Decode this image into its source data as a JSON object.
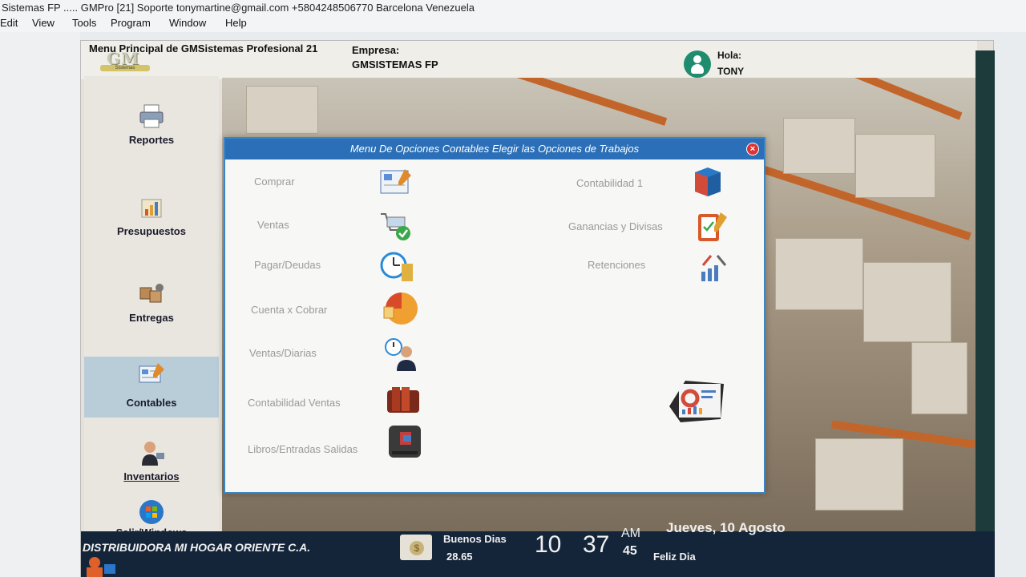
{
  "window": {
    "title": "Sistemas FP ..... GMPro [21] Soporte tonymartine@gmail.com +5804248506770 Barcelona Venezuela"
  },
  "menubar": [
    "Edit",
    "View",
    "Tools",
    "Program",
    "Window",
    "Help"
  ],
  "header": {
    "app_title": "Menu Principal de GMSistemas Profesional 21",
    "empresa_label": "Empresa:",
    "empresa_value": "GMSISTEMAS FP",
    "greeting": "Hola:",
    "user": "TONY",
    "logo_text": "GM",
    "logo_sub": "Sistemas"
  },
  "sidebar": {
    "items": [
      {
        "label": "Reportes",
        "icon": "printer-icon"
      },
      {
        "label": "Presupuestos",
        "icon": "budget-chart-icon"
      },
      {
        "label": "Entregas",
        "icon": "delivery-boxes-icon"
      },
      {
        "label": "Contables",
        "icon": "ledger-pencil-icon"
      },
      {
        "label": "Inventarios",
        "icon": "worker-icon"
      },
      {
        "label": "Salir/Windows",
        "icon": "windows-logo-icon"
      }
    ]
  },
  "dialog": {
    "title": "Menu De Opciones Contables Elegir las Opciones de Trabajos",
    "close_symbol": "×",
    "left_options": [
      {
        "label": "Comprar",
        "icon": "purchase-form-icon"
      },
      {
        "label": "Ventas",
        "icon": "shopping-cart-check-icon"
      },
      {
        "label": "Pagar/Deudas",
        "icon": "clock-payment-icon"
      },
      {
        "label": "Cuenta x Cobrar",
        "icon": "pie-chart-icon"
      },
      {
        "label": "Ventas/Diarias",
        "icon": "clerk-clock-icon"
      },
      {
        "label": "Contabilidad Ventas",
        "icon": "books-icon"
      },
      {
        "label": "Libros/Entradas Salidas",
        "icon": "book-icon"
      }
    ],
    "right_options": [
      {
        "label": "Contabilidad 1",
        "icon": "cube-icon"
      },
      {
        "label": "Ganancias y Divisas",
        "icon": "clipboard-check-icon"
      },
      {
        "label": "Retenciones",
        "icon": "tools-chart-icon"
      }
    ],
    "extra_icon": "dashboard-chart-icon"
  },
  "statusbar": {
    "company": "DISTRIBUIDORA MI HOGAR ORIENTE C.A.",
    "greeting": "Buenos Dias",
    "rate": "28.65",
    "coin_symbol": "$",
    "hour": "10",
    "minute": "37",
    "ampm": "AM",
    "second": "45",
    "date": "Jueves, 10 Agosto",
    "wish": "Feliz Dia"
  },
  "colors": {
    "dialog_title_bg": "#2a6fb7",
    "statusbar_bg": "#14253a",
    "active_nav_bg": "#b9cdd9",
    "avatar_bg": "#1f8c6e"
  }
}
